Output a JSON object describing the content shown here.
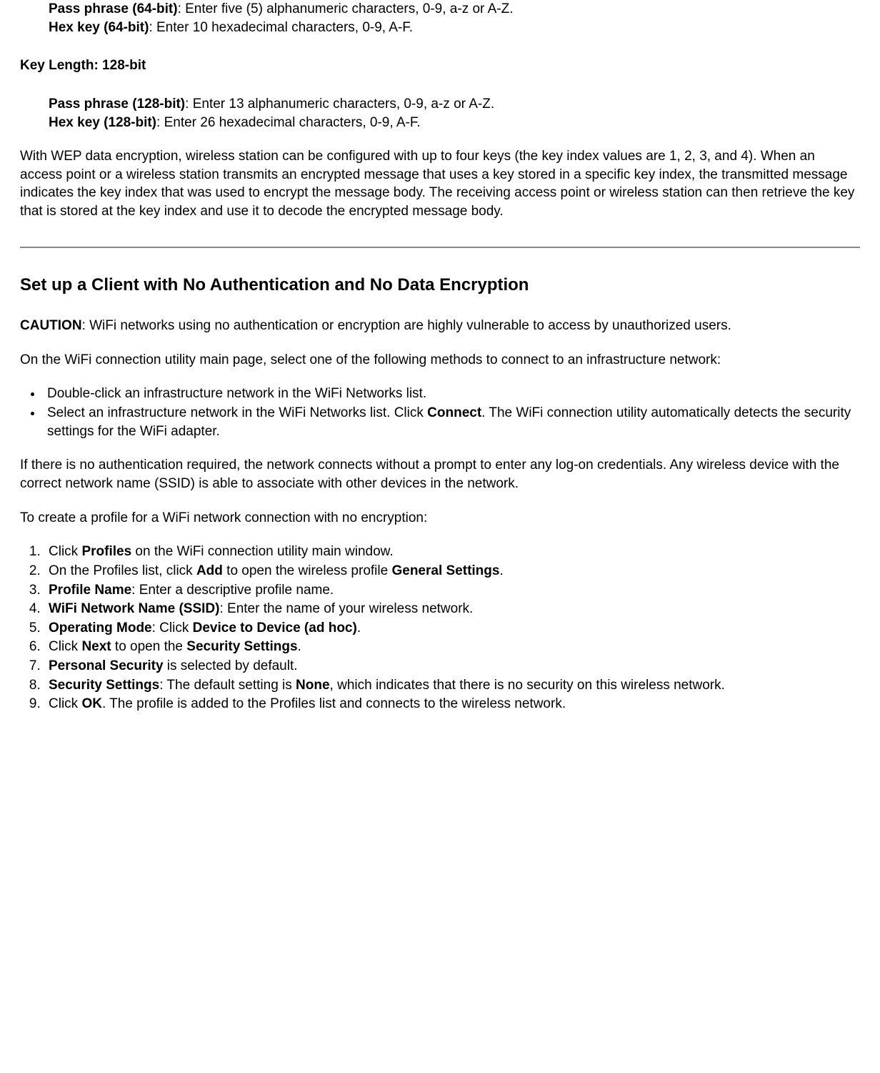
{
  "k64": {
    "pass_label": "Pass phrase (64-bit)",
    "pass_text": ": Enter five (5) alphanumeric characters, 0-9, a-z or A-Z.",
    "hex_label": "Hex key (64-bit)",
    "hex_text": ": Enter 10 hexadecimal characters, 0-9, A-F."
  },
  "k128_heading": "Key Length: 128-bit",
  "k128": {
    "pass_label": "Pass phrase (128-bit)",
    "pass_text": ": Enter 13 alphanumeric characters, 0-9, a-z or A-Z.",
    "hex_label": "Hex key (128-bit)",
    "hex_text": ": Enter 26 hexadecimal characters, 0-9, A-F."
  },
  "wep_para": "With WEP data encryption, wireless station can be configured with up to four keys (the key index values are 1, 2, 3, and 4). When an access point or a wireless station transmits an encrypted message that uses a key stored in a specific key index, the transmitted message indicates the key index that was used to encrypt the message body. The receiving access point or wireless station can then retrieve the key that is stored at the key index and use it to decode the encrypted message body.",
  "section_heading": "Set up a Client with No Authentication and No Data Encryption",
  "caution": {
    "label": "CAUTION",
    "text": ": WiFi networks using no authentication or encryption are highly vulnerable to access by unauthorized users."
  },
  "connect_intro": "On the WiFi connection utility main page, select one of the following methods to connect to an infrastructure network:",
  "bullets": {
    "b1": "Double-click an infrastructure network in the WiFi Networks list.",
    "b2_pre": "Select an infrastructure network in the WiFi Networks list. Click ",
    "b2_bold": "Connect",
    "b2_post": ". The WiFi connection utility automatically detects the security settings for the WiFi adapter."
  },
  "no_auth_para": "If there is no authentication required, the network connects without a prompt to enter any log-on credentials. Any wireless device with the correct network name (SSID) is able to associate with other devices in the network.",
  "profile_intro": "To create a profile for a WiFi network connection with no encryption:",
  "steps": {
    "s1_pre": "Click ",
    "s1_b1": "Profiles",
    "s1_post": " on the WiFi connection utility main window.",
    "s2_pre": "On the Profiles list, click ",
    "s2_b1": "Add",
    "s2_mid": " to open the wireless profile ",
    "s2_b2": "General Settings",
    "s2_post": ".",
    "s3_b1": "Profile Name",
    "s3_post": ": Enter a descriptive profile name.",
    "s4_b1": "WiFi Network Name (SSID)",
    "s4_post": ": Enter the name of your wireless network.",
    "s5_b1": "Operating Mode",
    "s5_mid": ": Click ",
    "s5_b2": "Device to Device (ad hoc)",
    "s5_post": ".",
    "s6_pre": "Click ",
    "s6_b1": "Next",
    "s6_mid": " to open the ",
    "s6_b2": "Security Settings",
    "s6_post": ".",
    "s7_b1": "Personal Security",
    "s7_post": " is selected by default.",
    "s8_b1": "Security Settings",
    "s8_mid": ": The default setting is ",
    "s8_b2": "None",
    "s8_post": ", which indicates that there is no security on this wireless network.",
    "s9_pre": "Click ",
    "s9_b1": "OK",
    "s9_post": ". The profile is added to the Profiles list and connects to the wireless network."
  }
}
